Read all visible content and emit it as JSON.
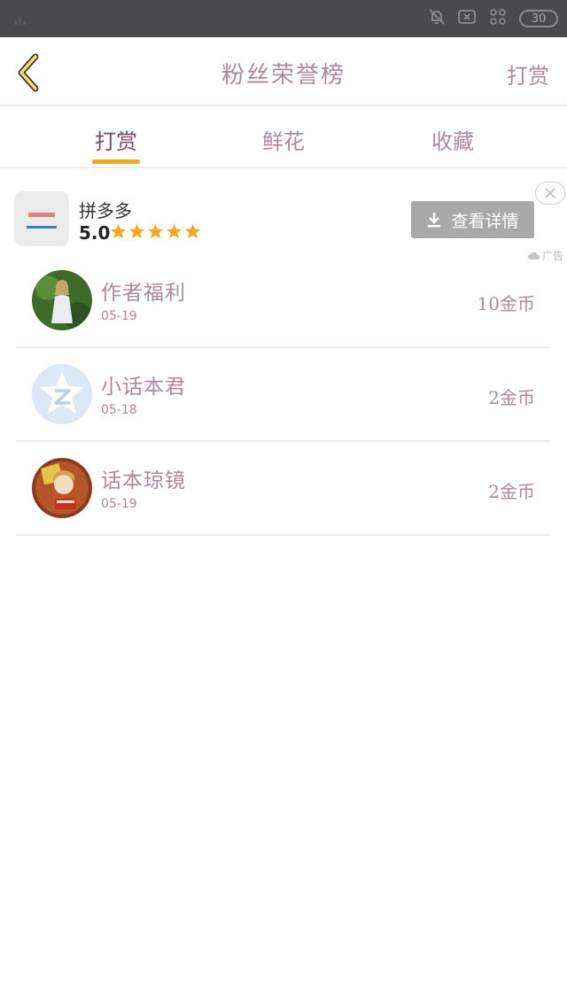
{
  "status_bar": {
    "battery_level": "30",
    "icons": [
      "mute-bell-icon",
      "close-box-icon",
      "network-icon",
      "battery-icon"
    ]
  },
  "header": {
    "title": "粉丝荣誉榜",
    "action_label": "打赏"
  },
  "tabs": [
    {
      "label": "打赏",
      "active": true
    },
    {
      "label": "鲜花",
      "active": false
    },
    {
      "label": "收藏",
      "active": false
    }
  ],
  "ad": {
    "app_name": "拼多多",
    "rating": "5.0",
    "stars": 5,
    "button_label": "查看详情",
    "ad_label": "广告"
  },
  "fans": [
    {
      "name": "作者福利",
      "date": "05-19",
      "amount": "10金币",
      "avatar": "girl-avatar"
    },
    {
      "name": "小话本君",
      "date": "05-18",
      "amount": "2金币",
      "avatar": "z-logo-avatar"
    },
    {
      "name": "话本琼镜",
      "date": "05-19",
      "amount": "2金币",
      "avatar": "anime-avatar"
    }
  ],
  "colors": {
    "accent": "#f5a623",
    "text": "#a8899d",
    "active_tab": "#7a4a64",
    "status_bar": "#4a4a4c"
  }
}
